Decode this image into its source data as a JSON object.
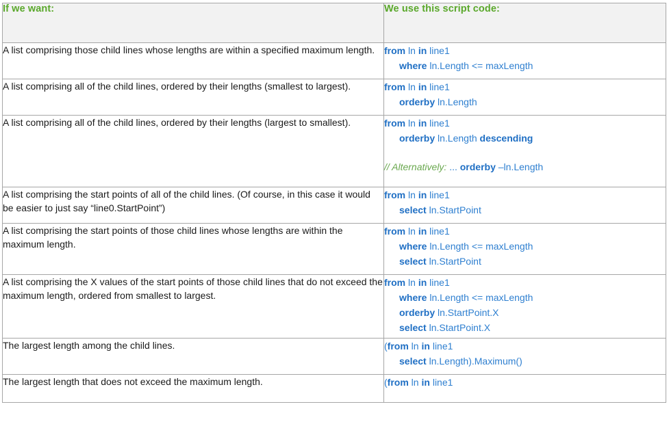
{
  "table": {
    "headers": {
      "want": "If we want:",
      "code": "We use this script code:"
    },
    "header_text_color": "#5aa82b",
    "header_bg_color": "#f2f2f2",
    "code_text_color": "#1f6fc4",
    "comment_text_color": "#6aa84f",
    "border_color": "#a6a6a6",
    "rows": [
      {
        "want": "A list comprising those child lines whose lengths are within a specified maximum length.",
        "code_lines": [
          {
            "indent": 0,
            "tokens": [
              {
                "t": "from",
                "style": "kw"
              },
              {
                "t": " ln ",
                "style": "id"
              },
              {
                "t": "in",
                "style": "kw"
              },
              {
                "t": " line1",
                "style": "id"
              }
            ]
          },
          {
            "indent": 1,
            "tokens": [
              {
                "t": "where",
                "style": "kw"
              },
              {
                "t": " ln.Length <= maxLength",
                "style": "id"
              }
            ]
          }
        ]
      },
      {
        "want": "A list comprising all of the child lines, ordered by their lengths (smallest to largest).",
        "code_lines": [
          {
            "indent": 0,
            "tokens": [
              {
                "t": "from",
                "style": "kw"
              },
              {
                "t": " ln ",
                "style": "id"
              },
              {
                "t": "in",
                "style": "kw"
              },
              {
                "t": " line1",
                "style": "id"
              }
            ]
          },
          {
            "indent": 1,
            "tokens": [
              {
                "t": "orderby",
                "style": "kw"
              },
              {
                "t": " ln.Length",
                "style": "id"
              }
            ]
          }
        ]
      },
      {
        "want": "A list comprising all of the child lines, ordered by their lengths (largest to smallest).",
        "code_lines": [
          {
            "indent": 0,
            "tokens": [
              {
                "t": "from",
                "style": "kw"
              },
              {
                "t": " ln ",
                "style": "id"
              },
              {
                "t": "in",
                "style": "kw"
              },
              {
                "t": " line1",
                "style": "id"
              }
            ]
          },
          {
            "indent": 1,
            "tokens": [
              {
                "t": "orderby",
                "style": "kw"
              },
              {
                "t": " ln.Length ",
                "style": "id"
              },
              {
                "t": "descending",
                "style": "kw"
              }
            ]
          },
          {
            "indent": 0,
            "blank": true,
            "tokens": []
          },
          {
            "indent": 0,
            "tokens": [
              {
                "t": "// Alternatively: ",
                "style": "comment"
              },
              {
                "t": "... ",
                "style": "id"
              },
              {
                "t": "orderby",
                "style": "kw"
              },
              {
                "t": " –ln.Length",
                "style": "id"
              }
            ]
          }
        ]
      },
      {
        "want": "A list comprising the start points of all of the child lines. (Of course, in this case it would be easier to just say “line0.StartPoint”)",
        "code_lines": [
          {
            "indent": 0,
            "tokens": [
              {
                "t": "from",
                "style": "kw"
              },
              {
                "t": " ln ",
                "style": "id"
              },
              {
                "t": "in",
                "style": "kw"
              },
              {
                "t": " line1",
                "style": "id"
              }
            ]
          },
          {
            "indent": 1,
            "tokens": [
              {
                "t": "select",
                "style": "kw"
              },
              {
                "t": " ln.StartPoint",
                "style": "id"
              }
            ]
          }
        ]
      },
      {
        "want": "A list comprising the start points of those child lines whose lengths are within the maximum length.",
        "code_lines": [
          {
            "indent": 0,
            "tokens": [
              {
                "t": "from",
                "style": "kw"
              },
              {
                "t": " ln ",
                "style": "id"
              },
              {
                "t": "in",
                "style": "kw"
              },
              {
                "t": " line1",
                "style": "id"
              }
            ]
          },
          {
            "indent": 1,
            "tokens": [
              {
                "t": "where",
                "style": "kw"
              },
              {
                "t": " ln.Length <= maxLength",
                "style": "id"
              }
            ]
          },
          {
            "indent": 1,
            "tokens": [
              {
                "t": "select",
                "style": "kw"
              },
              {
                "t": " ln.StartPoint",
                "style": "id"
              }
            ]
          }
        ]
      },
      {
        "want": "A list comprising the X values of the start points of those child lines that do not exceed the maximum length, ordered from smallest to largest.",
        "code_lines": [
          {
            "indent": 0,
            "tokens": [
              {
                "t": "from",
                "style": "kw"
              },
              {
                "t": " ln ",
                "style": "id"
              },
              {
                "t": "in",
                "style": "kw"
              },
              {
                "t": " line1",
                "style": "id"
              }
            ]
          },
          {
            "indent": 1,
            "tokens": [
              {
                "t": "where",
                "style": "kw"
              },
              {
                "t": " ln.Length <= maxLength",
                "style": "id"
              }
            ]
          },
          {
            "indent": 1,
            "tokens": [
              {
                "t": "orderby",
                "style": "kw"
              },
              {
                "t": " ln.StartPoint.X",
                "style": "id"
              }
            ]
          },
          {
            "indent": 1,
            "tokens": [
              {
                "t": "select",
                "style": "kw"
              },
              {
                "t": " ln.StartPoint.X",
                "style": "id"
              }
            ]
          }
        ]
      },
      {
        "want": "The largest length among the child lines.",
        "code_lines": [
          {
            "indent": 0,
            "tokens": [
              {
                "t": "(",
                "style": "id"
              },
              {
                "t": "from",
                "style": "kw"
              },
              {
                "t": " ln ",
                "style": "id"
              },
              {
                "t": "in",
                "style": "kw"
              },
              {
                "t": " line1",
                "style": "id"
              }
            ]
          },
          {
            "indent": 1,
            "tokens": [
              {
                "t": "select",
                "style": "kw"
              },
              {
                "t": " ln.Length).Maximum()",
                "style": "id"
              }
            ]
          }
        ]
      },
      {
        "want": "The largest length that does not exceed the maximum length.",
        "code_lines": [
          {
            "indent": 0,
            "tokens": [
              {
                "t": "(",
                "style": "id"
              },
              {
                "t": "from",
                "style": "kw"
              },
              {
                "t": " ln ",
                "style": "id"
              },
              {
                "t": "in",
                "style": "kw"
              },
              {
                "t": " line1",
                "style": "id"
              }
            ]
          }
        ]
      }
    ]
  }
}
